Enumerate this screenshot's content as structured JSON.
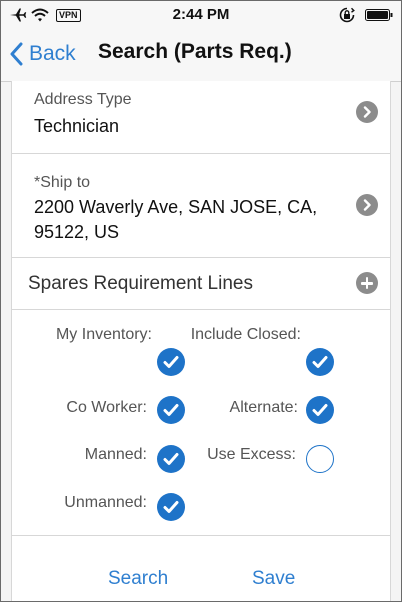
{
  "status_bar": {
    "time": "2:44 PM",
    "vpn": "VPN",
    "icons": [
      "airplane-icon",
      "wifi-icon",
      "vpn-badge",
      "orientation-lock-icon",
      "battery-icon"
    ]
  },
  "nav": {
    "back_label": "Back",
    "title": "Search (Parts Req.)",
    "accent_color": "#2f7fd0"
  },
  "fields": {
    "address_type": {
      "label": "Address Type",
      "value": "Technician"
    },
    "ship_to": {
      "label": "*Ship to",
      "value_line1": "2200 Waverly Ave, SAN JOSE, CA,",
      "value_line2": "95122, US"
    }
  },
  "section": {
    "title": "Spares Requirement Lines"
  },
  "options": {
    "my_inventory": {
      "label": "My Inventory:",
      "checked": true
    },
    "include_closed": {
      "label": "Include Closed:",
      "checked": true
    },
    "co_worker": {
      "label": "Co Worker:",
      "checked": true
    },
    "alternate": {
      "label": "Alternate:",
      "checked": true
    },
    "manned": {
      "label": "Manned:",
      "checked": true
    },
    "use_excess": {
      "label": "Use Excess:",
      "checked": false
    },
    "unmanned": {
      "label": "Unmanned:",
      "checked": true
    }
  },
  "footer": {
    "search_label": "Search",
    "save_label": "Save"
  },
  "colors": {
    "checkbox_blue": "#1e73c8",
    "chevron_gray": "#8c8c8c"
  }
}
